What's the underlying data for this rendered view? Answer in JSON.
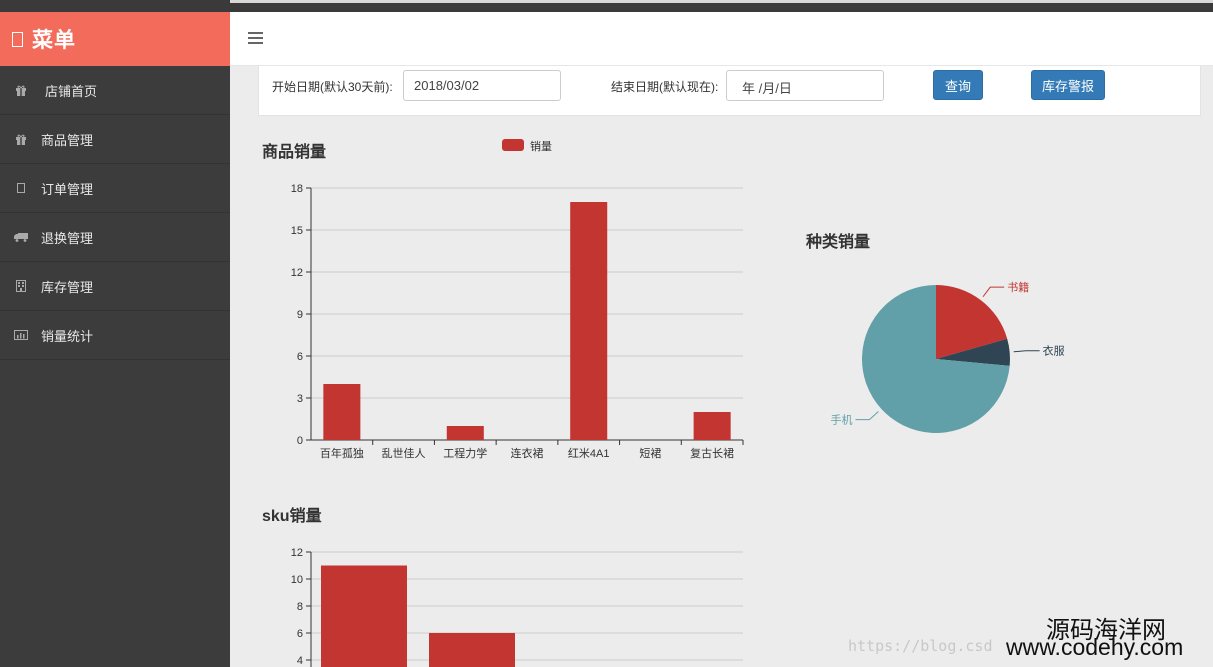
{
  "sidebar": {
    "brand": "菜单",
    "items": [
      {
        "label": "店铺首页",
        "icon": "gift-icon"
      },
      {
        "label": "商品管理",
        "icon": "gift-icon"
      },
      {
        "label": "订单管理",
        "icon": "file-icon"
      },
      {
        "label": "退换管理",
        "icon": "truck-icon"
      },
      {
        "label": "库存管理",
        "icon": "building-icon"
      },
      {
        "label": "销量统计",
        "icon": "bar-chart-icon"
      }
    ]
  },
  "filter": {
    "start_label": "开始日期(默认30天前):",
    "start_value": "2018/03/02",
    "end_label": "结束日期(默认现在):",
    "end_value": "年 /月/日",
    "query_button": "查询",
    "stock_alert_button": "库存警报"
  },
  "chart_data": [
    {
      "type": "bar",
      "title": "商品销量",
      "legend": "销量",
      "categories": [
        "百年孤独",
        "乱世佳人",
        "工程力学",
        "连衣裙",
        "红米4A1",
        "短裙",
        "复古长裙"
      ],
      "values": [
        4,
        0,
        1,
        0,
        17,
        0,
        2
      ],
      "ylim": [
        0,
        18
      ],
      "yticks": [
        "0",
        "3",
        "6",
        "9",
        "12",
        "15",
        "18"
      ],
      "color": "#c23531"
    },
    {
      "type": "pie",
      "title": "种类销量",
      "labels": [
        "书籍",
        "衣服",
        "手机"
      ],
      "values": [
        7,
        2,
        25
      ],
      "colors": [
        "#c23531",
        "#2f4554",
        "#61a0a8"
      ]
    },
    {
      "type": "bar",
      "title": "sku销量",
      "values": [
        11,
        6
      ],
      "yticks": [
        "4",
        "6",
        "8",
        "10",
        "12"
      ],
      "color": "#c23531"
    }
  ],
  "watermark": {
    "url": "https://blog.csd",
    "cn": "源码海洋网",
    "en": "www.codehy.com"
  }
}
